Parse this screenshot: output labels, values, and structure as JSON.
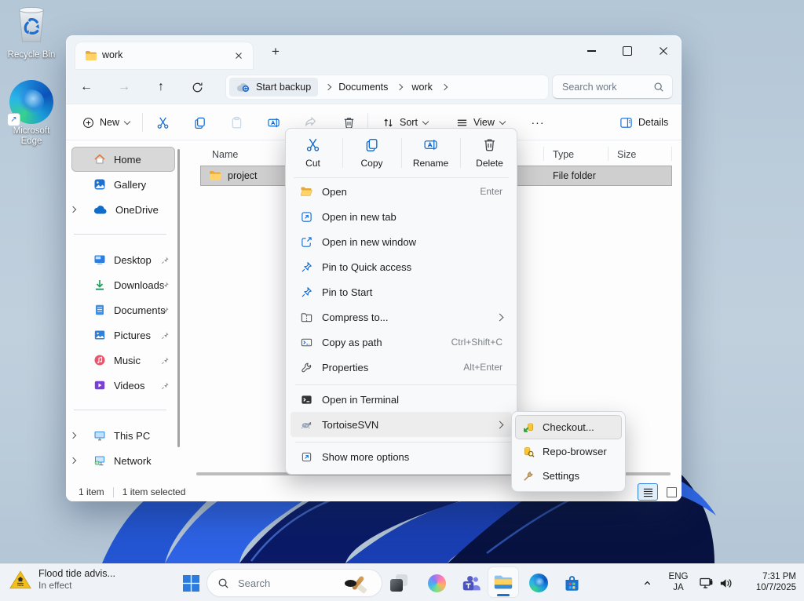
{
  "glyphs": {
    "back": "←",
    "forward": "→",
    "up": "↑",
    "plus": "+",
    "minimize": "–",
    "more": "···",
    "arrow_ne": "↗"
  },
  "desktop": {
    "icons": [
      {
        "label": "Recycle Bin"
      },
      {
        "label": "Microsoft Edge"
      }
    ]
  },
  "explorer": {
    "tab_title": "work",
    "breadcrumb": {
      "backup_label": "Start backup",
      "crumbs": [
        "Documents",
        "work"
      ]
    },
    "search_placeholder": "Search work",
    "toolbar": {
      "new": "New",
      "sort": "Sort",
      "view": "View",
      "details": "Details"
    },
    "sidebar": {
      "items": [
        {
          "label": "Home"
        },
        {
          "label": "Gallery"
        },
        {
          "label": "OneDrive"
        },
        {
          "label": "Desktop"
        },
        {
          "label": "Downloads"
        },
        {
          "label": "Documents"
        },
        {
          "label": "Pictures"
        },
        {
          "label": "Music"
        },
        {
          "label": "Videos"
        },
        {
          "label": "This PC"
        },
        {
          "label": "Network"
        }
      ]
    },
    "columns": [
      "Name",
      "Type",
      "Size"
    ],
    "rows": [
      {
        "name": "project",
        "type": "File folder"
      }
    ],
    "status": {
      "count": "1 item",
      "selected": "1 item selected"
    }
  },
  "context_menu": {
    "quick": [
      "Cut",
      "Copy",
      "Rename",
      "Delete"
    ],
    "items": [
      {
        "label": "Open",
        "shortcut": "Enter"
      },
      {
        "label": "Open in new tab"
      },
      {
        "label": "Open in new window"
      },
      {
        "label": "Pin to Quick access"
      },
      {
        "label": "Pin to Start"
      },
      {
        "label": "Compress to..."
      },
      {
        "label": "Copy as path",
        "shortcut": "Ctrl+Shift+C"
      },
      {
        "label": "Properties",
        "shortcut": "Alt+Enter"
      },
      {
        "label": "Open in Terminal"
      },
      {
        "label": "TortoiseSVN"
      },
      {
        "label": "Show more options"
      }
    ],
    "submenu": [
      {
        "label": "Checkout..."
      },
      {
        "label": "Repo-browser"
      },
      {
        "label": "Settings"
      }
    ]
  },
  "taskbar": {
    "weather": {
      "line1": "Flood tide advis...",
      "line2": "In effect"
    },
    "search_placeholder": "Search",
    "tray": {
      "lang1": "ENG",
      "lang2": "JA",
      "time": "7:31 PM",
      "date": "10/7/2025"
    }
  },
  "colors": {
    "accent": "#0d6bd6",
    "folder": "#ffd368",
    "selection": "#cfcfcf"
  }
}
